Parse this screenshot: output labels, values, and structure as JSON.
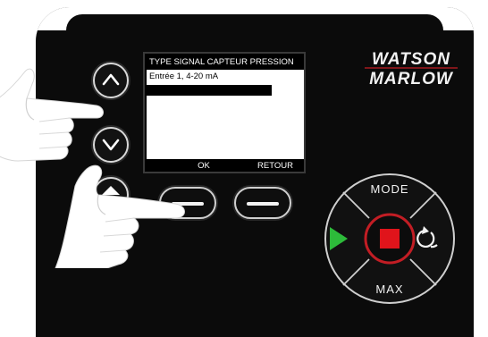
{
  "screen": {
    "title": "TYPE SIGNAL CAPTEUR PRESSION",
    "items": [
      "Entrée 1, 4-20 mA",
      ""
    ],
    "selected_index": 1,
    "softkeys": {
      "left": "OK",
      "right": "RETOUR"
    }
  },
  "logo": {
    "line1": "WATSON",
    "line2": "MARLOW"
  },
  "keypad": {
    "mode_label": "MODE",
    "max_label": "MAX"
  },
  "colors": {
    "panel": "#0b0b0b",
    "run_green": "#2dbb3a",
    "stop_red": "#e0141b",
    "accent_red": "#c21d24"
  }
}
